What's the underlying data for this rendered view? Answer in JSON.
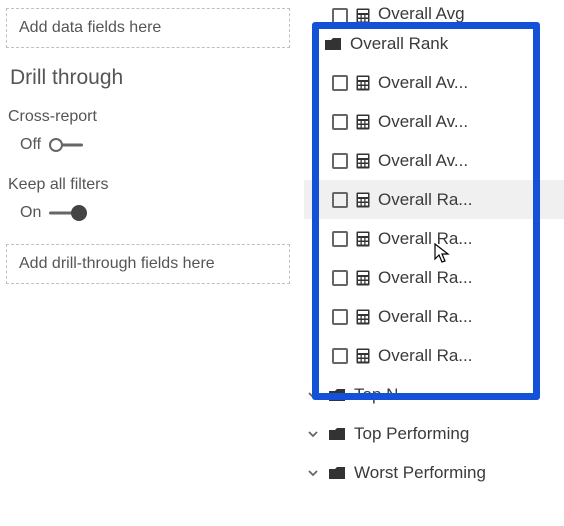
{
  "leftPane": {
    "dataFieldsPlaceholder": "Add data fields here",
    "drillThroughTitle": "Drill through",
    "crossReportLabel": "Cross-report",
    "crossReportState": "Off",
    "keepFiltersLabel": "Keep all filters",
    "keepFiltersState": "On",
    "drillFieldsPlaceholder": "Add drill-through fields here"
  },
  "fieldsTree": {
    "topPartial": "Overall Avg",
    "expandedFolder": "Overall Rank",
    "children": [
      "Overall Av...",
      "Overall Av...",
      "Overall Av...",
      "Overall Ra...",
      "Overall Ra...",
      "Overall Ra...",
      "Overall Ra...",
      "Overall Ra..."
    ],
    "belowFolders": [
      "Top N",
      "Top Performing",
      "Worst Performing"
    ]
  }
}
